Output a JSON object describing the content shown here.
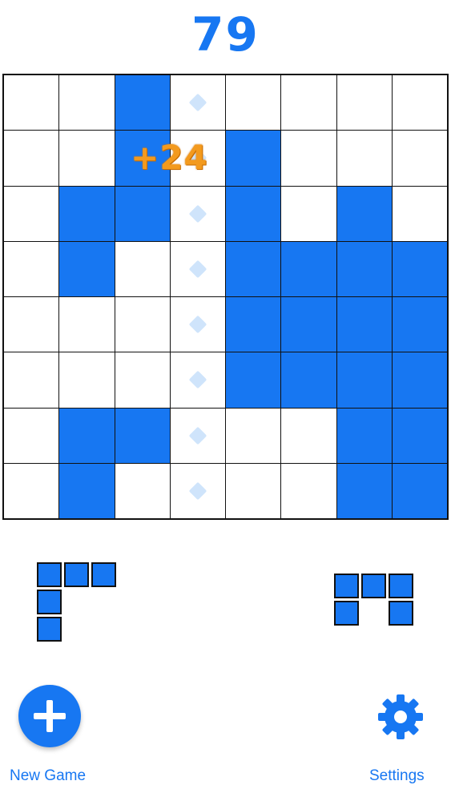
{
  "score": "79",
  "popup": "+24",
  "board": {
    "rows": 8,
    "cols": 8,
    "grid": [
      "..X.....",
      "..X.X...",
      ".XX.X.X.",
      ".X..XXXX",
      "....XXXX",
      "....XXXX",
      ".XX...XX",
      ".X....XX"
    ],
    "hint_column": 3
  },
  "pieces": [
    {
      "name": "piece-left",
      "cells": [
        [
          0,
          0
        ],
        [
          1,
          0
        ],
        [
          2,
          0
        ],
        [
          0,
          1
        ],
        [
          0,
          2
        ]
      ]
    },
    {
      "name": "piece-right",
      "cells": [
        [
          0,
          0
        ],
        [
          1,
          0
        ],
        [
          2,
          0
        ],
        [
          0,
          1
        ],
        [
          2,
          1
        ]
      ]
    }
  ],
  "buttons": {
    "new_game_label": "New Game",
    "settings_label": "Settings"
  },
  "colors": {
    "accent": "#1777f2",
    "popup": "#f39a1e",
    "hint": "#cfe4fb"
  }
}
